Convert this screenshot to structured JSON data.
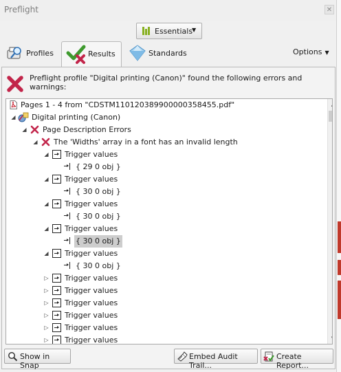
{
  "window": {
    "title": "Preflight",
    "close_glyph": "✕"
  },
  "toolbar": {
    "essentials_label": "Essentials",
    "essentials_arrow": "▼"
  },
  "tabs": [
    {
      "label": "Profiles",
      "icon": "magnifier-icon"
    },
    {
      "label": "Results",
      "icon": "check-cross-icon",
      "active": true
    },
    {
      "label": "Standards",
      "icon": "diamond-icon"
    }
  ],
  "options": {
    "label": "Options",
    "arrow": "▼"
  },
  "message": {
    "text": "Preflight profile \"Digital printing (Canon)\" found the following errors and warnings:",
    "icon": "red-x-icon"
  },
  "tree": {
    "pages": "Pages 1 - 4 from \"CDSTM110120389900000358455.pdf\"",
    "profile": "Digital printing (Canon)",
    "category": "Page Description Errors",
    "error": "The 'Widths' array in a font has an invalid length",
    "trigger_label": "Trigger values",
    "objects": [
      "{ 29 0 obj }",
      "{ 30 0 obj }",
      "{ 30 0 obj }",
      "{ 30 0 obj }",
      "{ 30 0 obj }"
    ],
    "selected_object_index": 3,
    "collapsed_trigger_count": 6
  },
  "buttons": {
    "show_in_snap": "Show in Snap",
    "embed_audit_trail": "Embed Audit Trail...",
    "create_report": "Create Report..."
  },
  "colors": {
    "error_red": "#c2254a",
    "accent_green": "#88b021",
    "selection_gray": "#cdcdcd"
  }
}
